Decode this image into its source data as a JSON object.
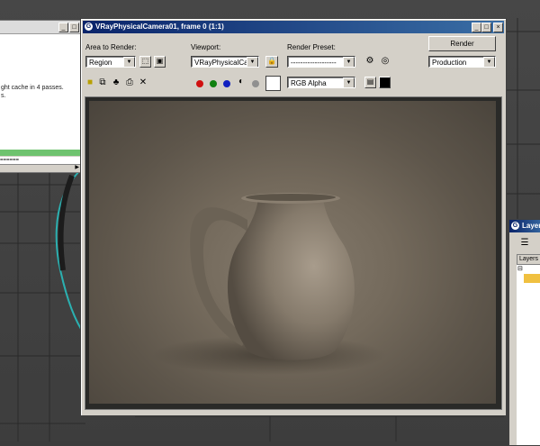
{
  "left_window": {
    "lines": [
      "ght cache in 4 passes.",
      "s."
    ],
    "log_text": "======",
    "progress": 1.0
  },
  "render_window": {
    "title": "VRayPhysicalCamera01, frame 0 (1:1)",
    "area_label": "Area to Render:",
    "area_value": "Region",
    "viewport_label": "Viewport:",
    "viewport_value": "VRayPhysicalCarr",
    "preset_label": "Render Preset:",
    "preset_value": "-------------------",
    "render_button": "Render",
    "production_value": "Production",
    "channel_value": "RGB Alpha",
    "colors": {
      "red": "#d01010",
      "green": "#108010",
      "blue": "#1020c0",
      "title_bar": "#0a246a"
    }
  },
  "layer_window": {
    "title": "Layer",
    "header": "Layers"
  }
}
